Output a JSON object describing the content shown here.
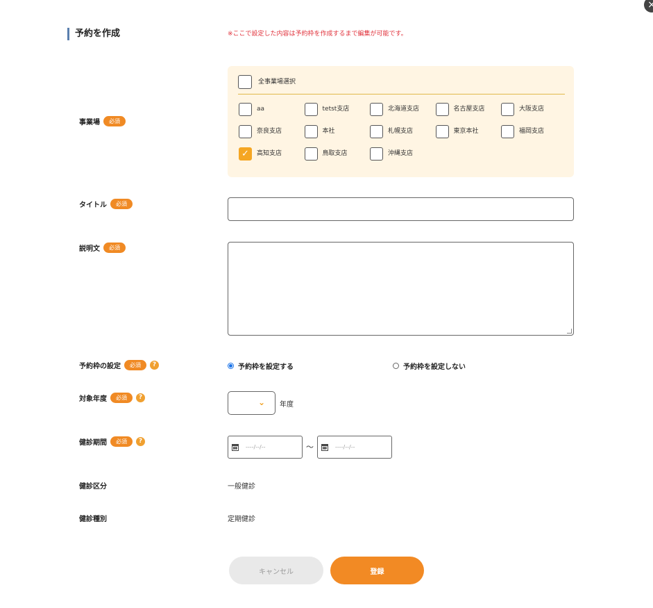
{
  "close_symbol": "×",
  "heading": "予約を作成",
  "notice": "※ここで設定した内容は予約枠を作成するまで編集が可能です。",
  "required_badge": "必須",
  "help_symbol": "?",
  "fields": {
    "office": "事業場",
    "title": "タイトル",
    "description": "説明文",
    "slot_setting": "予約枠の設定",
    "target_year": "対象年度",
    "exam_period": "健診期間",
    "exam_category": "健診区分",
    "exam_type": "健診種別"
  },
  "office_panel": {
    "select_all_label": "全事業場選択",
    "select_all_checked": false,
    "offices": [
      {
        "label": "aa",
        "checked": false
      },
      {
        "label": "tetst支店",
        "checked": false
      },
      {
        "label": "北海道支店",
        "checked": false
      },
      {
        "label": "名古屋支店",
        "checked": false
      },
      {
        "label": "大阪支店",
        "checked": false
      },
      {
        "label": "奈良支店",
        "checked": false
      },
      {
        "label": "本社",
        "checked": false
      },
      {
        "label": "札幌支店",
        "checked": false
      },
      {
        "label": "東京本社",
        "checked": false
      },
      {
        "label": "福岡支店",
        "checked": false
      },
      {
        "label": "高知支店",
        "checked": true
      },
      {
        "label": "鳥取支店",
        "checked": false
      },
      {
        "label": "沖縄支店",
        "checked": false
      }
    ]
  },
  "title_value": "",
  "description_value": "",
  "slot_options": [
    {
      "label": "予約枠を設定する",
      "selected": true
    },
    {
      "label": "予約枠を設定しない",
      "selected": false
    }
  ],
  "year": {
    "value": "",
    "suffix": "年度"
  },
  "period": {
    "start_placeholder": "----/--/--",
    "end_placeholder": "----/--/--",
    "separator": "〜"
  },
  "exam_category_value": "一般健診",
  "exam_type_value": "定期健診",
  "buttons": {
    "cancel": "キャンセル",
    "submit": "登録"
  },
  "colors": {
    "accent": "#f28a24",
    "notice": "#e0303a",
    "panel_bg": "#fff5e3"
  }
}
